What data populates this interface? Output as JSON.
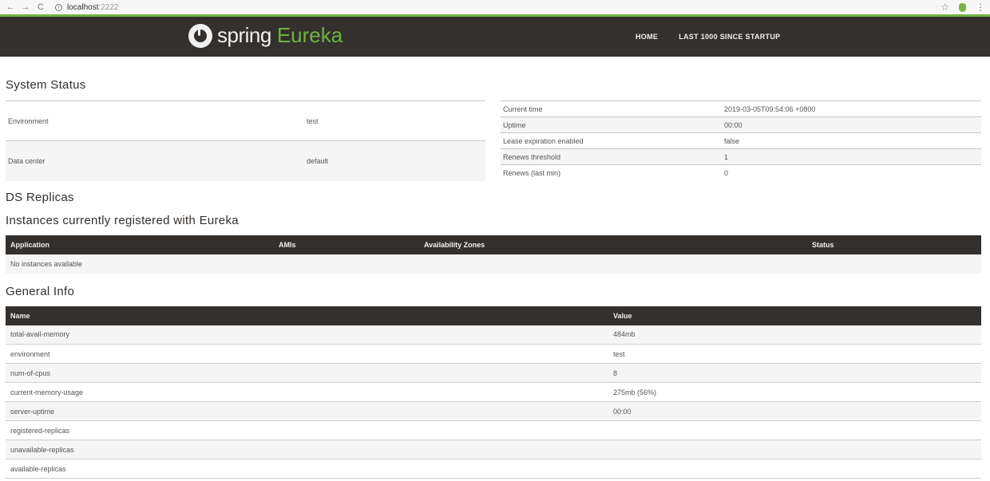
{
  "browser": {
    "back": "←",
    "forward": "→",
    "reload": "C",
    "info": "i",
    "url_host": "localhost",
    "url_port": ":2222",
    "star": "☆",
    "menu": "⋮"
  },
  "header": {
    "logo_spring": "spring",
    "logo_eureka": "Eureka",
    "nav": [
      "HOME",
      "LAST 1000 SINCE STARTUP"
    ]
  },
  "system_status": {
    "title": "System Status",
    "left": [
      {
        "label": "Environment",
        "value": "test"
      },
      {
        "label": "Data center",
        "value": "default"
      }
    ],
    "right": [
      {
        "label": "Current time",
        "value": "2019-03-05T09:54:06 +0800"
      },
      {
        "label": "Uptime",
        "value": "00:00"
      },
      {
        "label": "Lease expiration enabled",
        "value": "false"
      },
      {
        "label": "Renews threshold",
        "value": "1"
      },
      {
        "label": "Renews (last min)",
        "value": "0"
      }
    ]
  },
  "ds_replicas": {
    "title": "DS Replicas"
  },
  "instances": {
    "title": "Instances currently registered with Eureka",
    "columns": [
      "Application",
      "AMIs",
      "Availability Zones",
      "Status"
    ],
    "empty_message": "No instances available"
  },
  "general_info": {
    "title": "General Info",
    "columns": [
      "Name",
      "Value"
    ],
    "rows": [
      {
        "name": "total-avail-memory",
        "value": "484mb"
      },
      {
        "name": "environment",
        "value": "test"
      },
      {
        "name": "num-of-cpus",
        "value": "8"
      },
      {
        "name": "current-memory-usage",
        "value": "275mb (56%)"
      },
      {
        "name": "server-uptime",
        "value": "00:00"
      },
      {
        "name": "registered-replicas",
        "value": ""
      },
      {
        "name": "unavailable-replicas",
        "value": ""
      },
      {
        "name": "available-replicas",
        "value": ""
      }
    ]
  },
  "colors": {
    "header_bg": "#34302d",
    "accent_green": "#6db33f",
    "header_text": "#f1f1f1"
  }
}
